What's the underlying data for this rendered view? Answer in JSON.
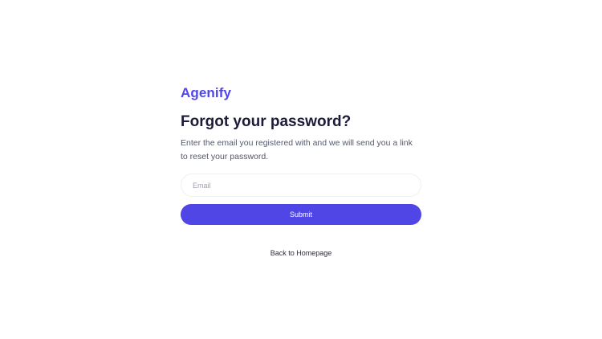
{
  "brand": {
    "name": "Agenify"
  },
  "form": {
    "title": "Forgot your password?",
    "subtitle": "Enter the email you registered with and we will send you a link to reset your password.",
    "email_placeholder": "Email",
    "email_value": "",
    "submit_label": "Submit"
  },
  "footer": {
    "back_link_label": "Back to Homepage"
  },
  "colors": {
    "accent": "#4f46e5",
    "brand_text": "#5046e5",
    "heading": "#1c1c3a",
    "body_text": "#55596b"
  }
}
